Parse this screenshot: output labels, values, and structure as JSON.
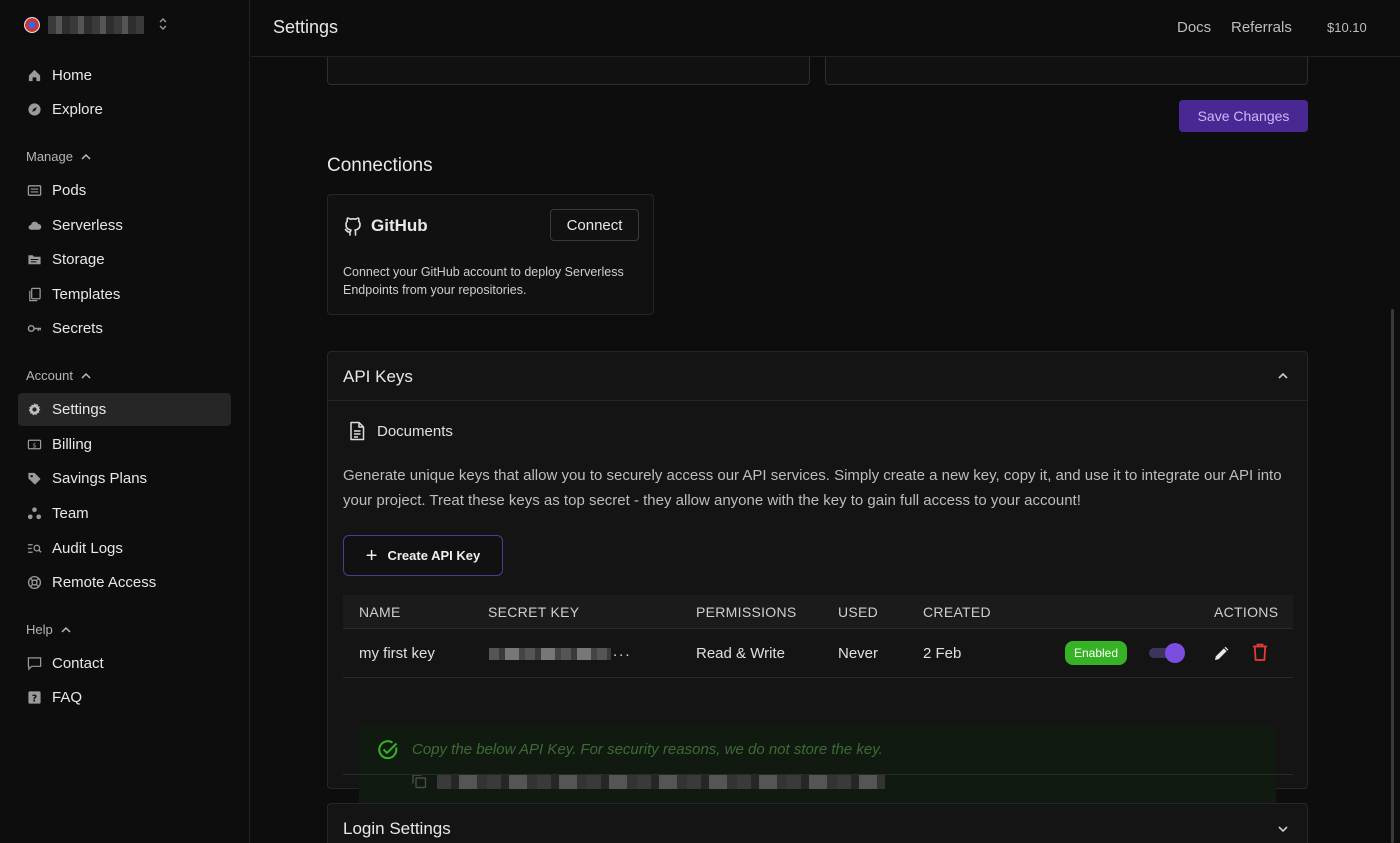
{
  "sidebar": {
    "workspace_chevron": "⌃⌄",
    "items_top": [
      {
        "label": "Home",
        "icon": "home-icon"
      },
      {
        "label": "Explore",
        "icon": "compass-icon"
      }
    ],
    "manage": {
      "label": "Manage",
      "items": [
        {
          "label": "Pods",
          "icon": "pods-icon"
        },
        {
          "label": "Serverless",
          "icon": "cloud-icon"
        },
        {
          "label": "Storage",
          "icon": "folder-icon"
        },
        {
          "label": "Templates",
          "icon": "templates-icon"
        },
        {
          "label": "Secrets",
          "icon": "key-icon"
        }
      ]
    },
    "account": {
      "label": "Account",
      "items": [
        {
          "label": "Settings",
          "icon": "gear-icon",
          "active": true
        },
        {
          "label": "Billing",
          "icon": "billing-icon"
        },
        {
          "label": "Savings Plans",
          "icon": "tag-icon"
        },
        {
          "label": "Team",
          "icon": "team-icon"
        },
        {
          "label": "Audit Logs",
          "icon": "audit-icon"
        },
        {
          "label": "Remote Access",
          "icon": "lifebuoy-icon"
        }
      ]
    },
    "help": {
      "label": "Help",
      "items": [
        {
          "label": "Contact",
          "icon": "chat-icon"
        },
        {
          "label": "FAQ",
          "icon": "question-icon"
        }
      ]
    }
  },
  "header": {
    "title": "Settings",
    "docs": "Docs",
    "referrals": "Referrals",
    "balance": "$10.10"
  },
  "profile": {
    "save_label": "Save Changes"
  },
  "connections": {
    "title": "Connections",
    "github": {
      "name": "GitHub",
      "connect_label": "Connect",
      "description": "Connect your GitHub account to deploy Serverless Endpoints from your repositories."
    }
  },
  "api_keys": {
    "title": "API Keys",
    "documents_label": "Documents",
    "description": "Generate unique keys that allow you to securely access our API services. Simply create a new key, copy it, and use it to integrate our API into your project. Treat these keys as top secret - they allow anyone with the key to gain full access to your account!",
    "create_label": "Create API Key",
    "columns": {
      "name": "NAME",
      "secret": "SECRET KEY",
      "permissions": "PERMISSIONS",
      "used": "USED",
      "created": "CREATED",
      "actions": "ACTIONS"
    },
    "rows": [
      {
        "name": "my first key",
        "secret_suffix": "...",
        "permissions": "Read & Write",
        "used": "Never",
        "created": "2 Feb",
        "status": "Enabled",
        "enabled": true
      }
    ],
    "copy_message": "Copy the below API Key. For security reasons, we do not store the key."
  },
  "login_settings": {
    "title": "Login Settings"
  },
  "colors": {
    "accent": "#7b4de0",
    "save_bg": "#4a2894",
    "enabled_green": "#36b324",
    "delete_red": "#e23b3b"
  }
}
